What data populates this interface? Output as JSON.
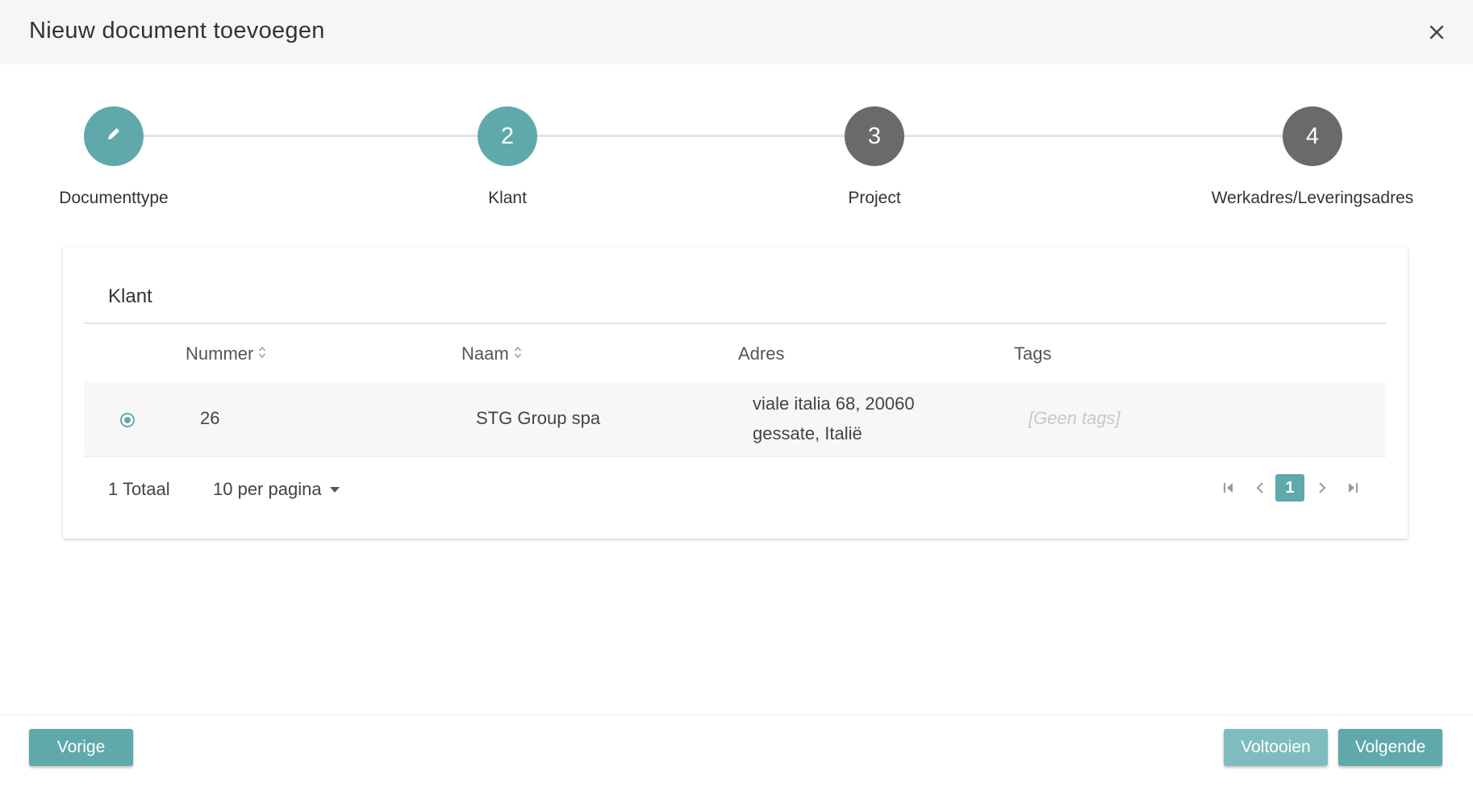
{
  "dialog": {
    "title": "Nieuw document toevoegen",
    "close_icon": "close-icon"
  },
  "stepper": {
    "steps": [
      {
        "label": "Documenttype",
        "marker": "",
        "icon": "pencil-icon",
        "state": "done"
      },
      {
        "label": "Klant",
        "marker": "2",
        "state": "active"
      },
      {
        "label": "Project",
        "marker": "3",
        "state": "pending"
      },
      {
        "label": "Werkadres/Leveringsadres",
        "marker": "4",
        "state": "pending"
      }
    ]
  },
  "table": {
    "title": "Klant",
    "columns": [
      {
        "label": "Nummer",
        "sortable": true
      },
      {
        "label": "Naam",
        "sortable": true
      },
      {
        "label": "Adres",
        "sortable": false
      },
      {
        "label": "Tags",
        "sortable": false
      }
    ],
    "rows": [
      {
        "selected": true,
        "nummer": "26",
        "naam": "STG Group spa",
        "adres_line1": "viale italia 68, 20060",
        "adres_line2": "gessate, Italië",
        "tags": "[Geen tags]"
      }
    ],
    "total_label": "1 Totaal",
    "per_page_label": "10 per pagina",
    "current_page": "1"
  },
  "footer": {
    "prev_label": "Vorige",
    "finish_label": "Voltooien",
    "next_label": "Volgende"
  },
  "colors": {
    "accent": "#5fa9aa",
    "inactive_step": "#6a6a6a"
  }
}
